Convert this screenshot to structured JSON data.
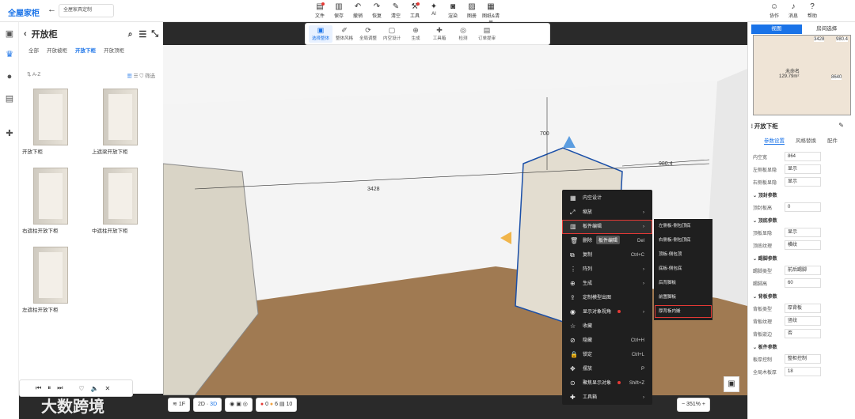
{
  "app": {
    "logo": "全屋家柜",
    "project": "全屋家具定制"
  },
  "toolbar": [
    {
      "label": "文件",
      "icon": "file-icon",
      "dot": true
    },
    {
      "label": "保存",
      "icon": "save-icon"
    },
    {
      "label": "撤销",
      "icon": "undo-icon"
    },
    {
      "label": "恢复",
      "icon": "redo-icon"
    },
    {
      "label": "清空",
      "icon": "eraser-icon"
    },
    {
      "label": "工具",
      "icon": "tool-icon",
      "dot": true
    },
    {
      "label": "AI",
      "icon": "ai-icon"
    },
    {
      "label": "渲染",
      "icon": "camera-icon"
    },
    {
      "label": "图册",
      "icon": "image-icon"
    },
    {
      "label": "图纸&清单",
      "icon": "drawing-icon"
    }
  ],
  "toolbar_right": [
    {
      "label": "协作",
      "icon": "user-icon"
    },
    {
      "label": "消息",
      "icon": "bell-icon"
    },
    {
      "label": "帮助",
      "icon": "help-icon"
    }
  ],
  "subtoolbar": [
    {
      "label": "选择整体",
      "icon": "select-icon",
      "active": true
    },
    {
      "label": "整体风格",
      "icon": "brush-icon"
    },
    {
      "label": "全局调整",
      "icon": "adjust-icon"
    },
    {
      "label": "内空设计",
      "icon": "space-icon"
    },
    {
      "label": "生成",
      "icon": "gen-icon"
    },
    {
      "label": "工具箱",
      "icon": "toolbox-icon"
    },
    {
      "label": "检测",
      "icon": "check-icon"
    },
    {
      "label": "订单提审",
      "icon": "order-icon"
    }
  ],
  "left_panel": {
    "title": "开放柜",
    "tabs": [
      "全部",
      "开放被柜",
      "开放下柜",
      "开放顶柜"
    ],
    "active_tab": "开放下柜",
    "sort": "A-Z",
    "filter": "筛选",
    "items": [
      "开放下柜",
      "上遮梁开放下柜",
      "右遮柱开放下柜",
      "中遮柱开放下柜",
      "左遮柱开放下柜"
    ]
  },
  "dims": {
    "width": "3428",
    "depth": "700",
    "side": "980.4"
  },
  "context_menu": [
    {
      "label": "内空设计",
      "icon": "grid-icon"
    },
    {
      "label": "缩放",
      "icon": "scale-icon",
      "arrow": true
    },
    {
      "label": "板件编辑",
      "icon": "board-icon",
      "arrow": true,
      "highlight": true
    },
    {
      "label": "删除",
      "icon": "trash-icon",
      "shortcut": "Del"
    },
    {
      "label": "复制",
      "icon": "copy-icon",
      "shortcut": "Ctrl+C"
    },
    {
      "label": "阵列",
      "icon": "array-icon",
      "arrow": true
    },
    {
      "label": "生成",
      "icon": "gen-icon",
      "arrow": true
    },
    {
      "label": "定制模型出图",
      "icon": "export-icon"
    },
    {
      "label": "显示对象视角",
      "icon": "eye-icon",
      "arrow": true,
      "dot": true
    },
    {
      "label": "收藏",
      "icon": "star-icon"
    },
    {
      "label": "隐藏",
      "icon": "hide-icon",
      "shortcut": "Ctrl+H"
    },
    {
      "label": "锁定",
      "icon": "lock-icon",
      "shortcut": "Ctrl+L"
    },
    {
      "label": "摆放",
      "icon": "move-icon",
      "shortcut": "P"
    },
    {
      "label": "聚焦显示对象",
      "icon": "focus-icon",
      "shortcut": "Shift+Z",
      "dot": true
    },
    {
      "label": "工具箱",
      "icon": "toolbox-icon",
      "arrow": true
    }
  ],
  "tooltip": "板件编辑",
  "submenu": [
    {
      "label": "左侧板-侧包顶底"
    },
    {
      "label": "右侧板-侧包顶底"
    },
    {
      "label": "顶板-侧包顶"
    },
    {
      "label": "底板-侧包底"
    },
    {
      "label": "后背脚板"
    },
    {
      "label": "前置脚板"
    },
    {
      "label": "厚背板内嵌",
      "highlight": true
    }
  ],
  "bottombar": {
    "floor": "1F",
    "mode2d": "2D",
    "mode3d": "3D",
    "errors": "0",
    "warnings": "6",
    "info": "10",
    "zoom": "351",
    "zoom_unit": "%"
  },
  "right_panel": {
    "tabs": [
      "视图",
      "房间选择"
    ],
    "room": "未命名",
    "area": "129.79m²",
    "dim_a": "3428",
    "dim_b": "980.4",
    "dim_c": "8640",
    "prop_title": "开放下柜",
    "prop_tabs": [
      "参数设置",
      "风格替换",
      "配件"
    ],
    "rows": [
      {
        "label": "内空宽",
        "value": "864",
        "type": "text"
      },
      {
        "label": "左侧板显隐",
        "value": "显示",
        "type": "select"
      },
      {
        "label": "右侧板显隐",
        "value": "显示",
        "type": "select"
      },
      {
        "label": "顶封参数",
        "section": true
      },
      {
        "label": "顶封板高",
        "value": "0",
        "type": "text"
      },
      {
        "label": "顶底参数",
        "section": true
      },
      {
        "label": "顶板显隐",
        "value": "显示",
        "type": "select"
      },
      {
        "label": "顶底纹理",
        "value": "横纹",
        "type": "select"
      },
      {
        "label": "踢脚参数",
        "section": true
      },
      {
        "label": "踢脚类型",
        "value": "前后踢脚",
        "type": "select"
      },
      {
        "label": "踢脚高",
        "value": "60",
        "type": "text"
      },
      {
        "label": "背板参数",
        "section": true
      },
      {
        "label": "背板类型",
        "value": "厚背板",
        "type": "select"
      },
      {
        "label": "背板纹理",
        "value": "竖纹",
        "type": "select"
      },
      {
        "label": "背板嵌边",
        "value": "否",
        "type": "select"
      },
      {
        "label": "板件参数",
        "section": true
      },
      {
        "label": "板厚控制",
        "value": "整柜控制",
        "type": "select"
      },
      {
        "label": "全局木板厚",
        "value": "18",
        "type": "text"
      }
    ]
  },
  "watermark": "大数跨境"
}
